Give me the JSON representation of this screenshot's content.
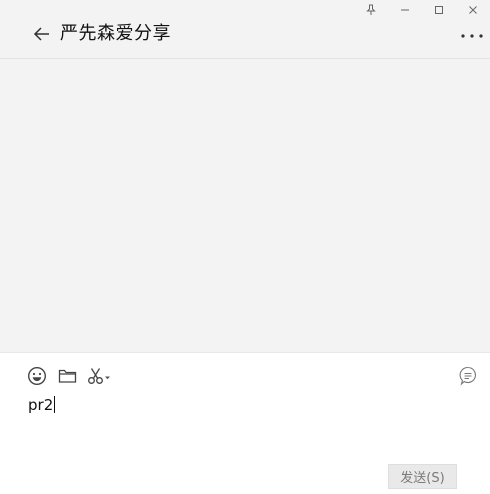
{
  "window": {
    "controls": [
      "pin-icon",
      "minimize-icon",
      "maximize-icon",
      "close-icon"
    ]
  },
  "header": {
    "back_icon": "arrow-left-icon",
    "title": "严先森爱分享",
    "more_icon": "more-icon"
  },
  "composer": {
    "tools": [
      "emoji-icon",
      "folder-icon",
      "scissors-icon"
    ],
    "history_icon": "chat-history-icon",
    "input_value": "pr2",
    "send_label": "发送(S)"
  },
  "colors": {
    "background": "#f3f3f3",
    "composer_background": "#ffffff",
    "send_button": "#e9e9e9"
  }
}
